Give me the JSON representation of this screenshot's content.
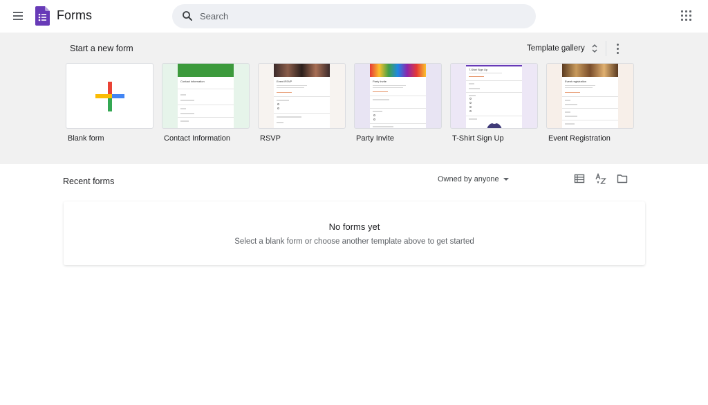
{
  "header": {
    "app_title": "Forms",
    "search_placeholder": "Search"
  },
  "templates": {
    "section_label": "Start a new form",
    "gallery_label": "Template gallery",
    "items": [
      {
        "label": "Blank form",
        "mini_title": ""
      },
      {
        "label": "Contact Information",
        "mini_title": "Contact information"
      },
      {
        "label": "RSVP",
        "mini_title": "Event RSVP"
      },
      {
        "label": "Party Invite",
        "mini_title": "Party Invite"
      },
      {
        "label": "T-Shirt Sign Up",
        "mini_title": "T-Shirt Sign Up"
      },
      {
        "label": "Event Registration",
        "mini_title": "Event registration"
      }
    ]
  },
  "recent": {
    "title": "Recent forms",
    "owner_filter": "Owned by anyone",
    "empty_title": "No forms yet",
    "empty_subtitle": "Select a blank form or choose another template above to get started"
  },
  "colors": {
    "forms_purple": "#673ab7",
    "template_band": "#f1f1f1",
    "search_bg": "#eef0f4",
    "plus_red": "#ea4335",
    "plus_blue": "#4285f4",
    "plus_green": "#34a853",
    "plus_yellow": "#fbbc04"
  }
}
